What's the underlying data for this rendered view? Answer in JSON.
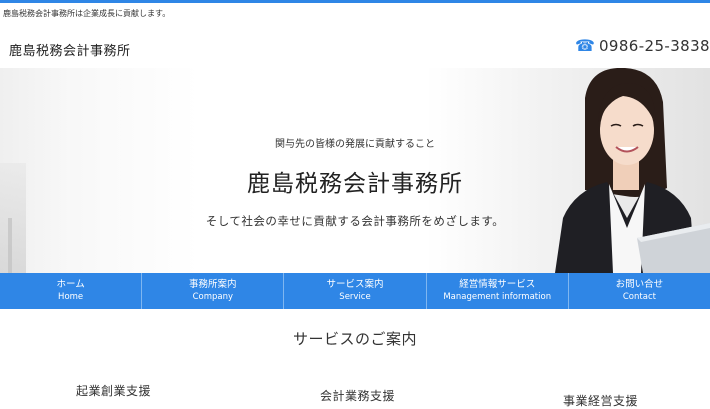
{
  "header": {
    "tagline": "鹿島税務会計事務所は企業成長に貢献します。",
    "site_title": "鹿島税務会計事務所",
    "phone_icon": "phone-icon",
    "phone_number": "0986-25-3838"
  },
  "hero": {
    "subheading": "関与先の皆様の発展に貢献すること",
    "title": "鹿島税務会計事務所",
    "description": "そして社会の幸せに貢献する会計事務所をめざします。"
  },
  "nav": {
    "items": [
      {
        "jp": "ホーム",
        "en": "Home"
      },
      {
        "jp": "事務所案内",
        "en": "Company"
      },
      {
        "jp": "サービス案内",
        "en": "Service"
      },
      {
        "jp": "経営情報サービス",
        "en": "Management information"
      },
      {
        "jp": "お問い合せ",
        "en": "Contact"
      }
    ]
  },
  "services": {
    "heading": "サービスのご案内",
    "items": [
      "起業創業支援",
      "会計業務支援",
      "事業経営支援"
    ]
  },
  "colors": {
    "accent": "#2f86e6",
    "text": "#333333"
  }
}
